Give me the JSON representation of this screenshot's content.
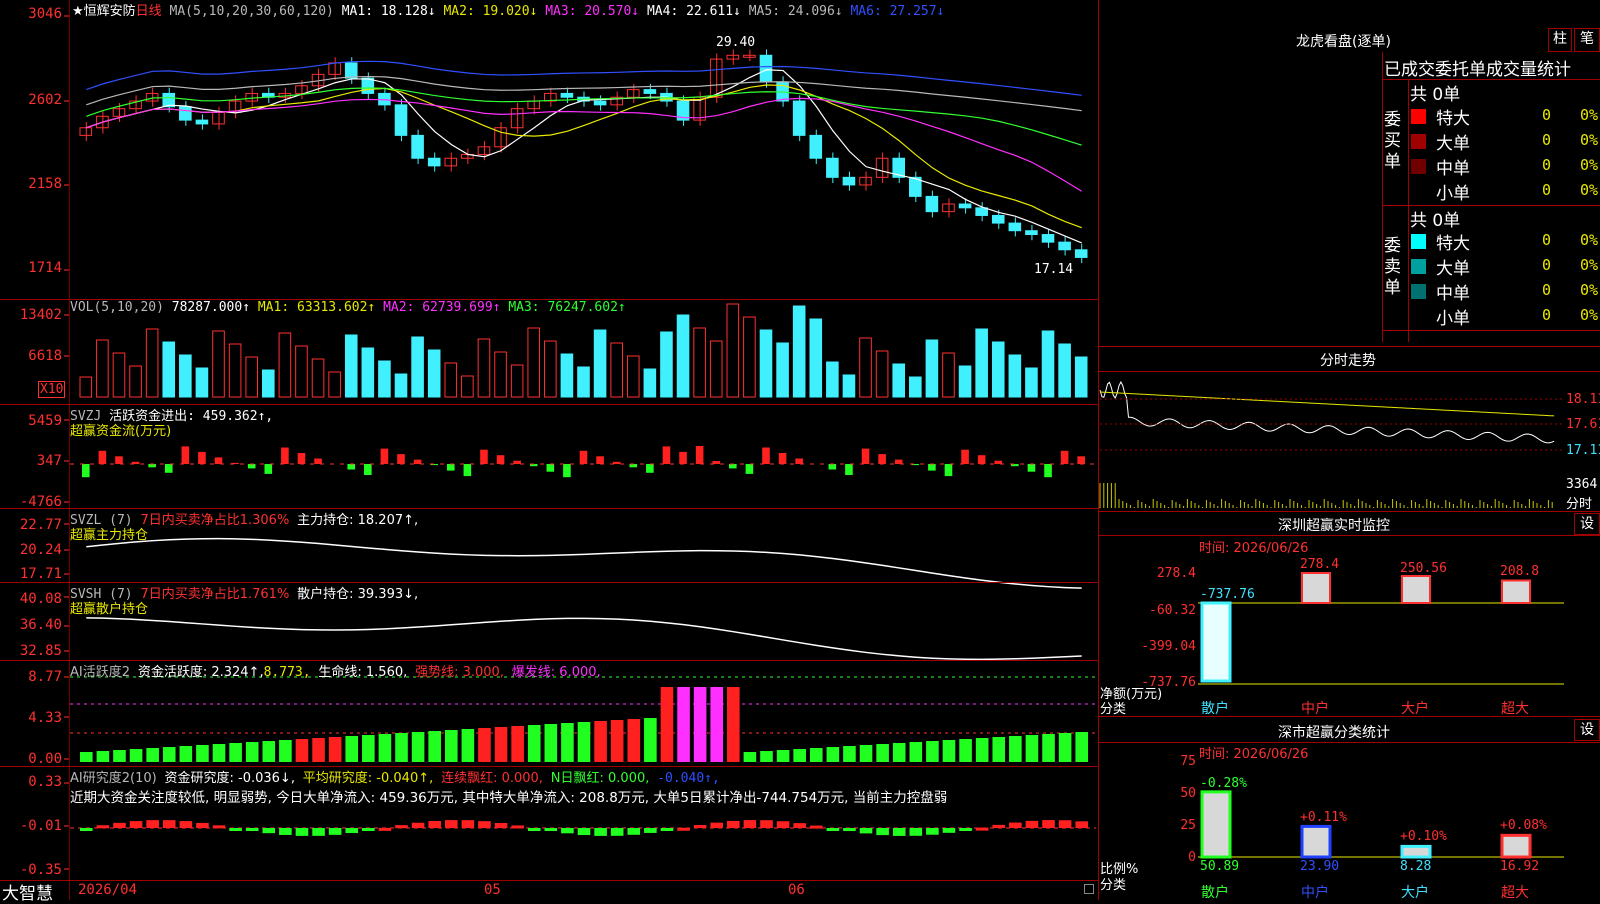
{
  "app_name": "大智慧",
  "stock": {
    "name": "恒辉安防",
    "period": "日线",
    "star": "★"
  },
  "price_panel": {
    "ma_header": "MA(5,10,20,30,60,120)",
    "ma1": "MA1: 18.128↓",
    "ma2": "MA2: 19.020↓",
    "ma3": "MA3: 20.570↓",
    "ma4": "MA4: 22.611↓",
    "ma5": "MA5: 24.096↓",
    "ma6": "MA6: 27.257↓",
    "y_labels": [
      "3046",
      "2602",
      "2158",
      "1714"
    ],
    "high_label": "29.40",
    "low_label": "17.14"
  },
  "vol_panel": {
    "header": "VOL(5,10,20)",
    "value": "78287.000↑",
    "ma1": "MA1: 63313.602↑",
    "ma2": "MA2: 62739.699↑",
    "ma3": "MA3: 76247.602↑",
    "y_labels": [
      "13402",
      "6618"
    ],
    "unit": "X10"
  },
  "svzj_panel": {
    "header": "SVZJ",
    "item": "活跃资金进出: 459.362↑,",
    "subtitle": "超赢资金流(万元)",
    "y_labels": [
      "5459",
      "347",
      "-4766"
    ]
  },
  "svzl_panel": {
    "header": "SVZL (7)",
    "item1": "7日内买卖净占比1.306%",
    "item2": "主力持仓: 18.207↑,",
    "subtitle": "超赢主力持仓",
    "y_labels": [
      "22.77",
      "20.24",
      "17.71"
    ]
  },
  "svsh_panel": {
    "header": "SVSH (7)",
    "item1": "7日内买卖净占比1.761%",
    "item2": "散户持仓: 39.393↓,",
    "subtitle": "超赢散户持仓",
    "y_labels": [
      "40.08",
      "36.40",
      "32.85"
    ]
  },
  "ai_active_panel": {
    "header": "AI活跃度2",
    "item1": "资金活跃度: 2.324↑,",
    "item2": "8.773,",
    "item3": "生命线: 1.560,",
    "item4": "强势线: 3.000,",
    "item5": "爆发线: 6.000,",
    "y_labels": [
      "8.77",
      "4.33",
      "0.00"
    ]
  },
  "ai_research_panel": {
    "header": "AI研究度2(10)",
    "item1": "资金研究度: -0.036↓,",
    "item2": "平均研究度: -0.040↑,",
    "item3": "连续飘红: 0.000,",
    "item4": "N日飘红: 0.000,",
    "item5": "-0.040↑,",
    "commentary": "近期大资金关注度较低, 明显弱势, 今日大单净流入: 459.36万元, 其中特大单净流入: 208.8万元, 大单5日累计净出-744.754万元, 当前主力控盘弱",
    "y_labels": [
      "0.33",
      "-0.01",
      "-0.35"
    ]
  },
  "x_axis": {
    "labels": [
      "2026/04",
      "05",
      "06"
    ]
  },
  "right_panel": {
    "dragon_tiger": {
      "title": "龙虎看盘(逐单)",
      "btn1": "柱",
      "btn2": "笔"
    },
    "order_stats": {
      "tabs": [
        "已成交",
        "委托单",
        "成交量",
        "统计"
      ],
      "buy_label": "委买单",
      "sell_label": "委卖单",
      "buy_total": "共 0单",
      "sell_total": "共 0单",
      "rows_buy": [
        {
          "label": "特大",
          "count": "0",
          "pct": "0%",
          "color": "#ff0000"
        },
        {
          "label": "大单",
          "count": "0",
          "pct": "0%",
          "color": "#a00000"
        },
        {
          "label": "中单",
          "count": "0",
          "pct": "0%",
          "color": "#700000"
        },
        {
          "label": "小单",
          "count": "0",
          "pct": "0%",
          "color": "#000000"
        }
      ],
      "rows_sell": [
        {
          "label": "特大",
          "count": "0",
          "pct": "0%",
          "color": "#00ffff"
        },
        {
          "label": "大单",
          "count": "0",
          "pct": "0%",
          "color": "#00a0a0"
        },
        {
          "label": "中单",
          "count": "0",
          "pct": "0%",
          "color": "#007070"
        },
        {
          "label": "小单",
          "count": "0",
          "pct": "0%",
          "color": "#000000"
        }
      ]
    },
    "intraday": {
      "title": "分时走势",
      "prices": [
        "18.11",
        "17.61",
        "17.11"
      ],
      "vol": "3364",
      "vol_unit": "分时"
    },
    "sz_monitor": {
      "title": "深圳超赢实时监控",
      "btn": "设",
      "time": "时间: 2026/06/26",
      "y_labels": [
        "278.4",
        "-60.32",
        "-399.04",
        "-737.76"
      ],
      "y_title": "净额(万元)",
      "x_title": "分类",
      "categories": [
        "散户",
        "中户",
        "大户",
        "超大"
      ],
      "values": [
        "-737.76",
        "278.4",
        "250.56",
        "208.8"
      ]
    },
    "sz_classify": {
      "title": "深市超赢分类统计",
      "btn": "设",
      "time": "时间: 2026/06/26",
      "y_labels": [
        "75",
        "50",
        "25",
        "0"
      ],
      "y_title": "比例%",
      "x_title": "分类",
      "categories": [
        "散户",
        "中户",
        "大户",
        "超大"
      ],
      "pct_changes": [
        "-0.28%",
        "+0.11%",
        "+0.10%",
        "+0.08%"
      ],
      "values": [
        "50.89",
        "23.90",
        "8.28",
        "16.92"
      ]
    }
  }
}
